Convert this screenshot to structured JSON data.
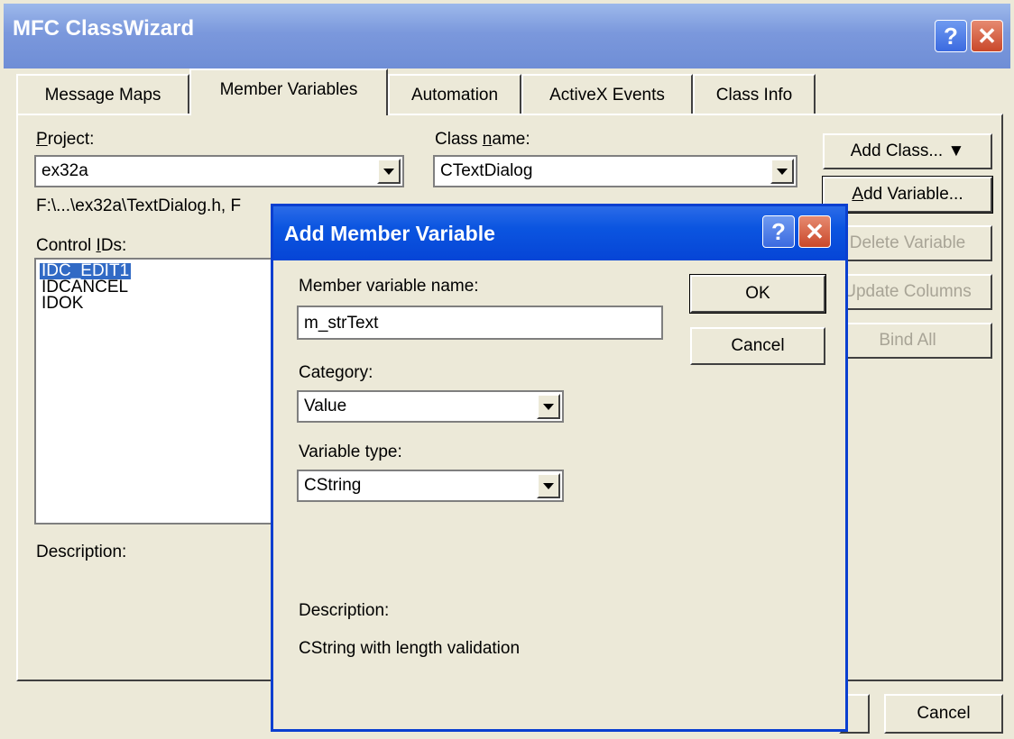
{
  "window": {
    "title": "MFC ClassWizard",
    "help": "?",
    "close": "✕"
  },
  "tabs": [
    {
      "label": "Message Maps"
    },
    {
      "label": "Member Variables"
    },
    {
      "label": "Automation"
    },
    {
      "label": "ActiveX Events"
    },
    {
      "label": "Class Info"
    }
  ],
  "project": {
    "label": "Project:",
    "label_u": "P",
    "label_rest": "roject:",
    "value": "ex32a"
  },
  "classname": {
    "label_a": "Class ",
    "label_u": "n",
    "label_b": "ame:",
    "value": "CTextDialog"
  },
  "filepath": "F:\\...\\ex32a\\TextDialog.h, F",
  "control_ids": {
    "label_a": "Control ",
    "label_u": "I",
    "label_b": "Ds:",
    "items": [
      "IDC_EDIT1",
      "IDCANCEL",
      "IDOK"
    ]
  },
  "description_label": "Description:",
  "right_buttons": {
    "add_class": "Add Class... ▼",
    "add_variable_u": "A",
    "add_variable_rest": "dd Variable...",
    "delete_variable": "Delete Variable",
    "update_columns": "Update Columns",
    "bind_all": "Bind All"
  },
  "bottom_cancel": "Cancel",
  "dialog": {
    "title": "Add Member Variable",
    "help": "?",
    "close": "✕",
    "name_label": "Member variable name:",
    "name_value": "m_strText",
    "ok": "OK",
    "cancel": "Cancel",
    "category_label": "Category:",
    "category_value": "Value",
    "vartype_label": "Variable type:",
    "vartype_value": "CString",
    "description_label": "Description:",
    "description_value": "CString with length validation"
  }
}
